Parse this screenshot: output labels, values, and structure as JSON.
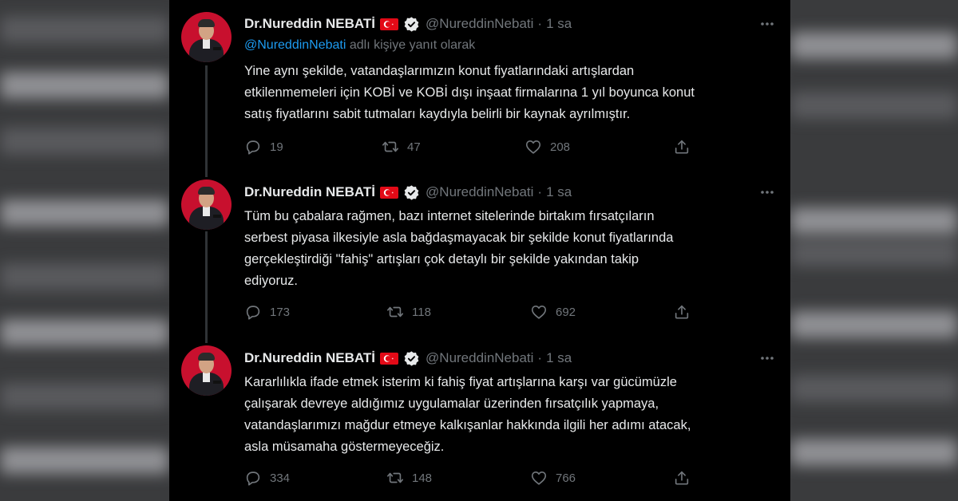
{
  "tweets": [
    {
      "name": "Dr.Nureddin NEBATİ",
      "handle": "@NureddinNebati",
      "separator": "·",
      "time": "1 sa",
      "reply_mention": "@NureddinNebati",
      "reply_suffix": " adlı kişiye yanıt olarak",
      "lines": [
        "Yine aynı şekilde, vatandaşlarımızın konut fiyatlarındaki artışlardan",
        "etkilenmemeleri için KOBİ ve KOBİ dışı inşaat firmalarına 1 yıl boyunca konut",
        "satış fiyatlarını sabit tutmaları kaydıyla belirli bir kaynak ayrılmıştır."
      ],
      "replies": "19",
      "retweets": "47",
      "likes": "208"
    },
    {
      "name": "Dr.Nureddin NEBATİ",
      "handle": "@NureddinNebati",
      "separator": "·",
      "time": "1 sa",
      "lines": [
        "Tüm bu çabalara rağmen, bazı internet sitelerinde birtakım fırsatçıların",
        "serbest piyasa ilkesiyle asla bağdaşmayacak bir şekilde konut fiyatlarında",
        "gerçekleştirdiği \"fahiş\" artışları çok detaylı bir şekilde yakından takip",
        "ediyoruz."
      ],
      "replies": "173",
      "retweets": "118",
      "likes": "692"
    },
    {
      "name": "Dr.Nureddin NEBATİ",
      "handle": "@NureddinNebati",
      "separator": "·",
      "time": "1 sa",
      "lines": [
        "Kararlılıkla ifade etmek isterim ki fahiş fiyat artışlarına karşı var gücümüzle",
        "çalışarak devreye aldığımız uygulamalar üzerinden fırsatçılık yapmaya,",
        "vatandaşlarımızı mağdur etmeye kalkışanlar hakkında ilgili her adımı atacak,",
        "asla müsamaha göstermeyeceğiz."
      ],
      "replies": "334",
      "retweets": "148",
      "likes": "766"
    }
  ],
  "icons": {
    "flag": "turkey-flag-icon",
    "verified": "verified-badge-icon",
    "more": "more-options-icon",
    "reply": "reply-icon",
    "retweet": "retweet-icon",
    "like": "like-icon",
    "share": "share-icon"
  },
  "colors": {
    "background": "#000000",
    "text": "#e7e9ea",
    "muted": "#71767b",
    "link": "#1d9bf0",
    "flag_red": "#e30a17",
    "avatar_red": "#c8102e"
  }
}
